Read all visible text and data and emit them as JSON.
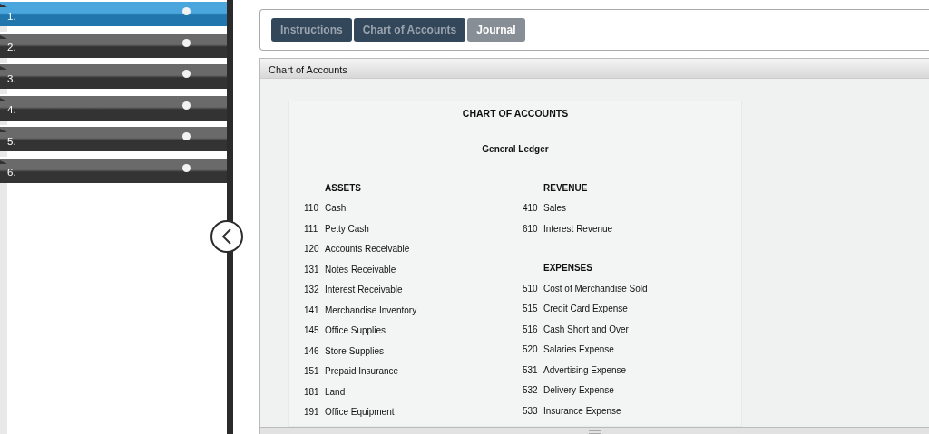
{
  "sidebar": {
    "items": [
      {
        "label": "1.",
        "selected": true
      },
      {
        "label": "2.",
        "selected": false
      },
      {
        "label": "3.",
        "selected": false
      },
      {
        "label": "4.",
        "selected": false
      },
      {
        "label": "5.",
        "selected": false
      },
      {
        "label": "6.",
        "selected": false
      }
    ]
  },
  "tabs": [
    {
      "label": "Instructions",
      "selected": false
    },
    {
      "label": "Chart of Accounts",
      "selected": false
    },
    {
      "label": "Journal",
      "selected": true
    }
  ],
  "panel": {
    "title": "Chart of Accounts",
    "chart": {
      "title": "CHART OF ACCOUNTS",
      "subtitle": "General Ledger",
      "columns": [
        {
          "sections": [
            {
              "heading": "ASSETS",
              "accounts": [
                {
                  "number": "110",
                  "name": "Cash"
                },
                {
                  "number": "111",
                  "name": "Petty Cash"
                },
                {
                  "number": "120",
                  "name": "Accounts Receivable"
                },
                {
                  "number": "131",
                  "name": "Notes Receivable"
                },
                {
                  "number": "132",
                  "name": "Interest Receivable"
                },
                {
                  "number": "141",
                  "name": "Merchandise Inventory"
                },
                {
                  "number": "145",
                  "name": "Office Supplies"
                },
                {
                  "number": "146",
                  "name": "Store Supplies"
                },
                {
                  "number": "151",
                  "name": "Prepaid Insurance"
                },
                {
                  "number": "181",
                  "name": "Land"
                },
                {
                  "number": "191",
                  "name": "Office Equipment"
                }
              ]
            }
          ]
        },
        {
          "sections": [
            {
              "heading": "REVENUE",
              "accounts": [
                {
                  "number": "410",
                  "name": "Sales"
                },
                {
                  "number": "610",
                  "name": "Interest Revenue"
                }
              ]
            },
            {
              "heading": "EXPENSES",
              "accounts": [
                {
                  "number": "510",
                  "name": "Cost of Merchandise Sold"
                },
                {
                  "number": "515",
                  "name": "Credit Card Expense"
                },
                {
                  "number": "516",
                  "name": "Cash Short and Over"
                },
                {
                  "number": "520",
                  "name": "Salaries Expense"
                },
                {
                  "number": "531",
                  "name": "Advertising Expense"
                },
                {
                  "number": "532",
                  "name": "Delivery Expense"
                },
                {
                  "number": "533",
                  "name": "Insurance Expense"
                }
              ]
            }
          ]
        }
      ]
    }
  }
}
